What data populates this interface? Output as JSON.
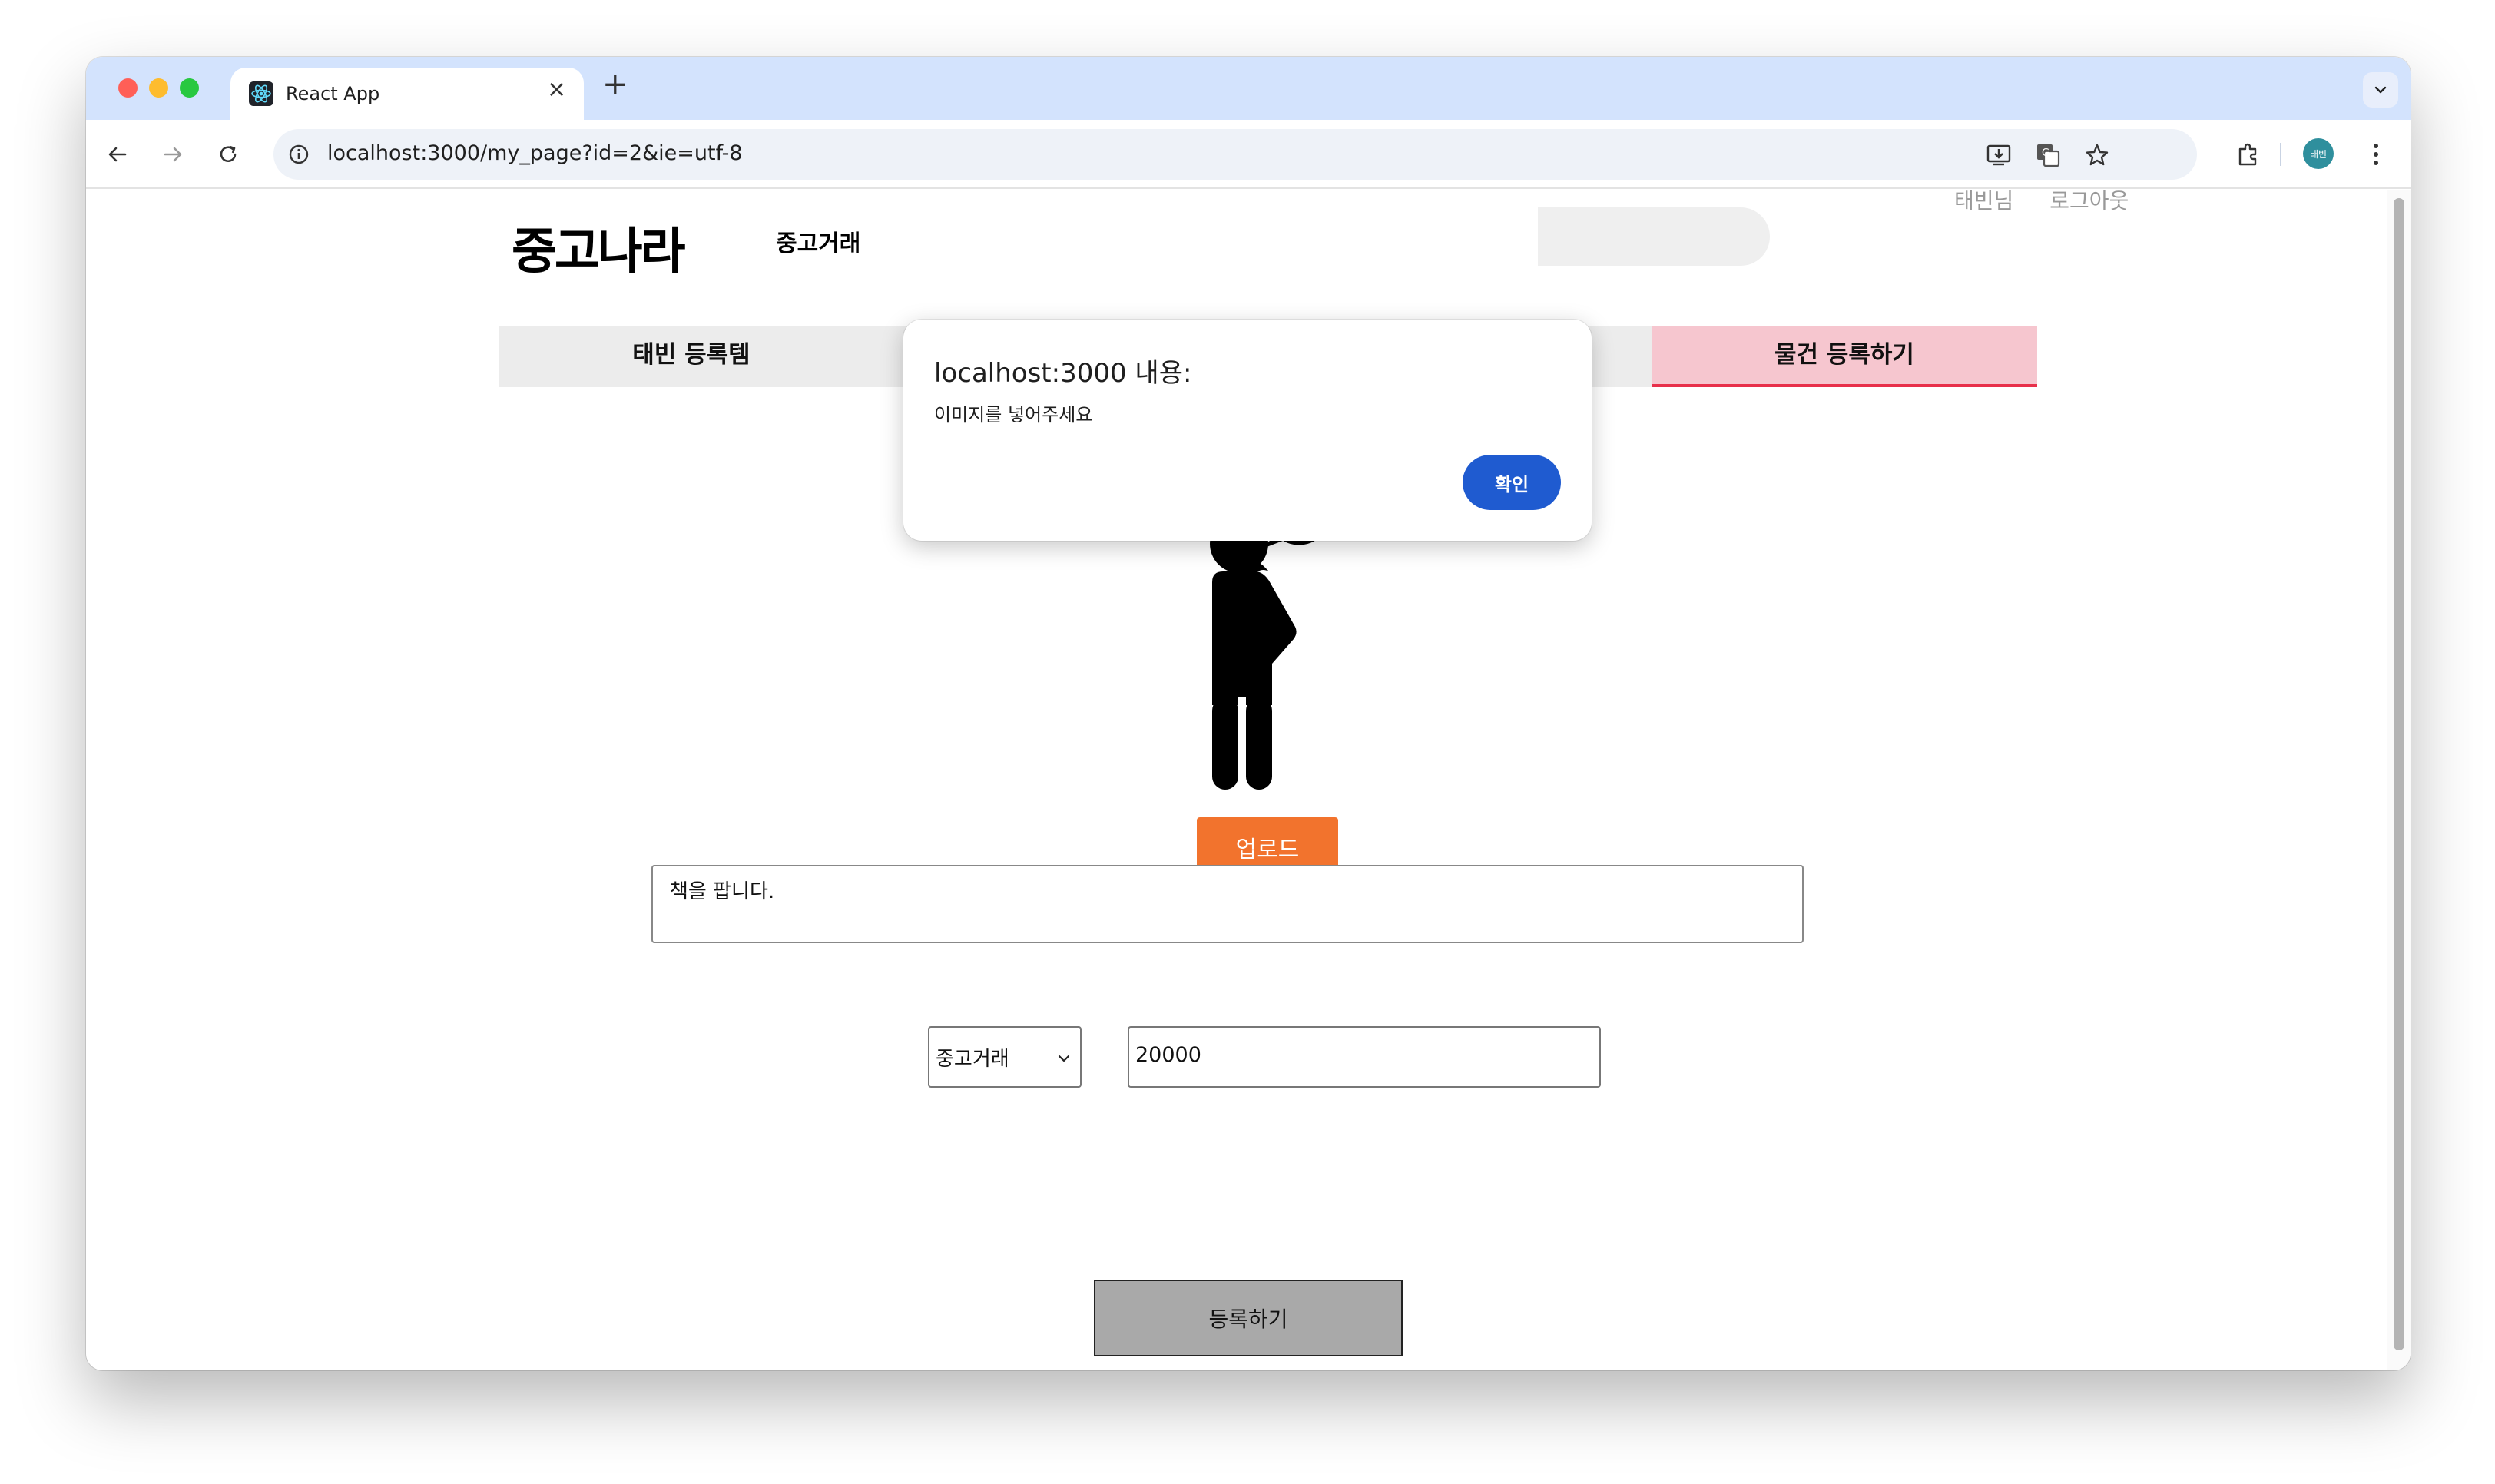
{
  "browser": {
    "tab_title": "React App",
    "url": "localhost:3000/my_page?id=2&ie=utf-8",
    "profile_label": "태빈",
    "icons": {
      "favicon": "react-icon",
      "close": "close-icon",
      "new_tab": "plus-icon",
      "tab_search": "chevron-down-icon",
      "back": "back-arrow-icon",
      "forward": "forward-arrow-icon",
      "reload": "reload-icon",
      "site_info": "info-icon",
      "install": "install-app-icon",
      "translate": "translate-icon",
      "bookmark": "star-icon",
      "extensions": "puzzle-icon",
      "menu": "kebab-menu-icon"
    }
  },
  "header": {
    "logo": "중고나라",
    "category": "중고거래",
    "user_name": "태빈님",
    "logout": "로그아웃"
  },
  "tabs": [
    {
      "label": "태빈 등록템"
    },
    {
      "label": ""
    },
    {
      "label": "물건 등록하기",
      "active": true
    }
  ],
  "form": {
    "illustration": "person-question-icon",
    "upload_label": "업로드",
    "title_value": "책을 팝니다.",
    "category_value": "중고거래",
    "price_value": "20000",
    "submit_label": "등록하기"
  },
  "dialog": {
    "title": "localhost:3000 내용:",
    "message": "이미지를 넣어주세요",
    "ok_label": "확인"
  },
  "colors": {
    "tab_bar": "#d3e3fd",
    "active_tab": "#f6c6cf",
    "active_tab_border": "#e8304b",
    "upload_button": "#f2732d",
    "dialog_button": "#1f5bd0",
    "submit_button": "#a9a9a9"
  }
}
